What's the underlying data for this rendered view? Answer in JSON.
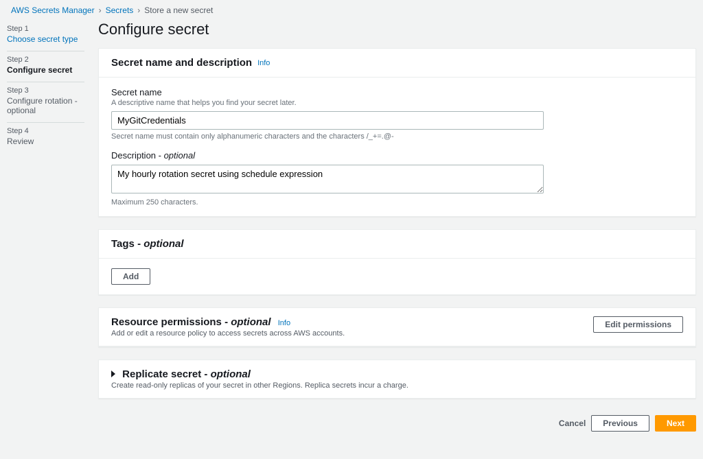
{
  "breadcrumb": {
    "root": "AWS Secrets Manager",
    "mid": "Secrets",
    "current": "Store a new secret"
  },
  "sidebar": {
    "steps": [
      {
        "num": "Step 1",
        "title": "Choose secret type"
      },
      {
        "num": "Step 2",
        "title": "Configure secret"
      },
      {
        "num": "Step 3",
        "title": "Configure rotation - optional"
      },
      {
        "num": "Step 4",
        "title": "Review"
      }
    ]
  },
  "page_title": "Configure secret",
  "section1": {
    "heading": "Secret name and description",
    "info": "Info",
    "name_label": "Secret name",
    "name_hint": "A descriptive name that helps you find your secret later.",
    "name_value": "MyGitCredentials",
    "name_constraint": "Secret name must contain only alphanumeric characters and the characters /_+=.@-",
    "desc_label": "Description - ",
    "desc_optional": "optional",
    "desc_value": "My hourly rotation secret using schedule expression",
    "desc_constraint": "Maximum 250 characters."
  },
  "tags": {
    "heading": "Tags  - ",
    "optional": "optional",
    "add_button": "Add"
  },
  "permissions": {
    "heading": "Resource permissions  - ",
    "optional": "optional",
    "info": "Info",
    "sub": "Add or edit a resource policy to access secrets across AWS accounts.",
    "edit_button": "Edit permissions"
  },
  "replicate": {
    "heading": "Replicate secret  - ",
    "optional": "optional",
    "sub": "Create read-only replicas of your secret in other Regions. Replica secrets incur a charge."
  },
  "footer": {
    "cancel": "Cancel",
    "previous": "Previous",
    "next": "Next"
  }
}
